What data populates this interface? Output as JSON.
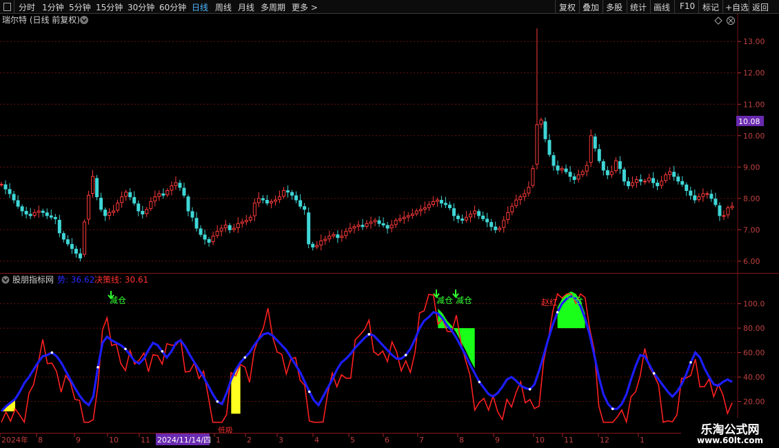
{
  "toolbar": {
    "periods": [
      "分时",
      "1分钟",
      "5分钟",
      "15分钟",
      "30分钟",
      "60分钟",
      "日线",
      "周线",
      "月线",
      "多周期",
      "更多 >"
    ],
    "active": "日线",
    "actions": [
      "复权",
      "叠加",
      "多股",
      "统计",
      "画线",
      "F10",
      "标记",
      "+自选",
      "返回"
    ]
  },
  "main": {
    "title": "瑞尔特 (日线 前复权)",
    "y_labels": [
      "13.00",
      "12.00",
      "11.00",
      "10.00",
      "9.00",
      "8.00",
      "7.00",
      "6.00"
    ],
    "price_tag": "10.08"
  },
  "indicator": {
    "name": "股朋指标网",
    "trend_label": "势: 36.62",
    "decision_label": "决策线: 30.61",
    "y_labels": [
      "100.0",
      "80.00",
      "60.00",
      "40.00",
      "20.00"
    ],
    "annotations": [
      "减仓",
      "减仓",
      "减仓",
      "赵红",
      "减仓",
      "低吸"
    ]
  },
  "date_axis": {
    "labels": [
      "2024年",
      "8",
      "9",
      "10",
      "11",
      "2024/11/14/四",
      "1",
      "2",
      "3",
      "4",
      "5",
      "6",
      "7",
      "8",
      "9",
      "10",
      "11",
      "12",
      "1"
    ]
  },
  "watermark": {
    "line1": "乐淘公式网",
    "line2": "www.60lt.com"
  },
  "colors": {
    "up": "#ff3b3b",
    "down": "#3fd6d6",
    "trend": "#1d1dff",
    "decision": "#ff2020",
    "grid": "#6a1010",
    "highlight": "#6a2ab0"
  },
  "chart_data": {
    "type": "candlestick+line",
    "y_range_price": [
      5.8,
      13.4
    ],
    "y_range_indicator": [
      0,
      115
    ],
    "price_close": [
      8.45,
      8.3,
      8.15,
      7.95,
      7.75,
      7.6,
      7.5,
      7.45,
      7.55,
      7.6,
      7.55,
      7.45,
      7.4,
      7.35,
      6.9,
      6.7,
      6.55,
      6.4,
      6.25,
      6.1,
      7.25,
      8.1,
      8.7,
      8.05,
      7.65,
      7.45,
      7.55,
      7.6,
      7.85,
      8.05,
      8.2,
      8.05,
      7.85,
      7.6,
      7.5,
      7.65,
      7.9,
      8.05,
      8.15,
      8.1,
      8.25,
      8.4,
      8.5,
      8.35,
      8.1,
      7.6,
      7.4,
      7.05,
      6.85,
      6.7,
      6.6,
      6.8,
      6.95,
      7.05,
      7.15,
      7.0,
      7.05,
      7.2,
      7.25,
      7.3,
      7.4,
      7.85,
      8.0,
      7.95,
      7.85,
      7.9,
      7.95,
      8.05,
      8.25,
      8.2,
      8.1,
      7.95,
      7.75,
      7.65,
      6.55,
      6.45,
      6.5,
      6.65,
      6.7,
      6.8,
      6.85,
      6.75,
      6.8,
      6.95,
      7.05,
      7.1,
      7.15,
      7.1,
      7.2,
      7.25,
      7.3,
      7.2,
      7.15,
      7.05,
      7.15,
      7.3,
      7.35,
      7.4,
      7.45,
      7.5,
      7.6,
      7.65,
      7.7,
      7.8,
      7.9,
      7.95,
      7.85,
      7.8,
      7.7,
      7.45,
      7.35,
      7.3,
      7.4,
      7.5,
      7.6,
      7.45,
      7.35,
      7.25,
      7.1,
      7.0,
      7.05,
      7.3,
      7.55,
      7.75,
      7.95,
      8.05,
      8.15,
      8.35,
      8.95,
      10.35,
      10.5,
      9.9,
      9.4,
      9.05,
      8.9,
      8.95,
      8.85,
      8.7,
      8.6,
      8.75,
      8.85,
      9.05,
      10.0,
      9.6,
      9.2,
      8.9,
      8.75,
      8.85,
      9.2,
      8.95,
      8.55,
      8.4,
      8.5,
      8.6,
      8.55,
      8.55,
      8.65,
      8.5,
      8.4,
      8.55,
      8.75,
      8.85,
      8.7,
      8.55,
      8.45,
      8.25,
      8.1,
      7.95,
      8.05,
      8.15,
      8.15,
      8.0,
      7.8,
      7.45,
      7.45,
      7.7,
      7.75
    ],
    "trend": [
      12,
      16,
      19,
      22,
      28,
      35,
      40,
      46,
      52,
      57,
      58,
      60,
      57,
      52,
      45,
      38,
      31,
      25,
      20,
      17,
      24,
      48,
      68,
      73,
      70,
      68,
      66,
      63,
      58,
      53,
      51,
      55,
      62,
      68,
      66,
      61,
      56,
      61,
      68,
      70,
      65,
      58,
      52,
      46,
      40,
      33,
      26,
      20,
      18,
      27,
      38,
      46,
      52,
      56,
      60,
      66,
      71,
      75,
      76,
      74,
      70,
      66,
      62,
      56,
      50,
      44,
      36,
      28,
      21,
      17,
      24,
      31,
      38,
      46,
      52,
      55,
      59,
      64,
      68,
      72,
      75,
      74,
      70,
      66,
      62,
      58,
      55,
      55,
      58,
      63,
      71,
      80,
      86,
      89,
      93,
      92,
      88,
      82,
      78,
      72,
      65,
      58,
      50,
      43,
      36,
      31,
      26,
      24,
      27,
      32,
      38,
      40,
      37,
      33,
      31,
      30,
      34,
      45,
      58,
      71,
      83,
      93,
      100,
      104,
      106,
      104,
      98,
      88,
      75,
      58,
      40,
      26,
      18,
      14,
      14,
      18,
      26,
      38,
      49,
      58,
      57,
      50,
      43,
      38,
      33,
      28,
      24,
      28,
      34,
      42,
      52,
      60,
      56,
      47,
      40,
      34,
      33,
      36,
      38,
      36
    ]
  }
}
